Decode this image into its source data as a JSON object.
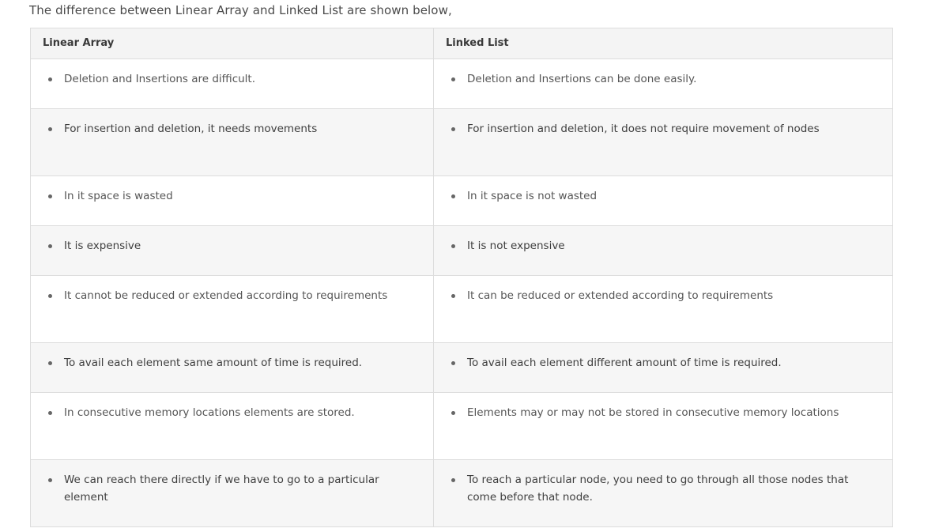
{
  "intro_text": "The difference between Linear Array and Linked List are shown below,",
  "table": {
    "headers": [
      "Linear Array",
      "Linked List"
    ],
    "rows": [
      [
        "Deletion and Insertions are difficult.",
        "Deletion and Insertions can be done easily."
      ],
      [
        "For insertion and deletion, it needs movements",
        "For insertion and deletion, it does not require movement of nodes"
      ],
      [
        "In it space is wasted",
        "In it space is not wasted"
      ],
      [
        "It is expensive",
        "It is not expensive"
      ],
      [
        "It cannot be reduced or extended according to requirements",
        "It can be reduced or extended according to requirements"
      ],
      [
        "To avail each element same amount of time is required.",
        "To avail each element different amount of time is required."
      ],
      [
        "In consecutive memory locations elements are stored.",
        "Elements may or may not be stored in consecutive memory locations"
      ],
      [
        "We can reach there directly if we have to go to a particular element",
        "To reach a particular node, you need to go through all those nodes that come before that node."
      ]
    ]
  }
}
